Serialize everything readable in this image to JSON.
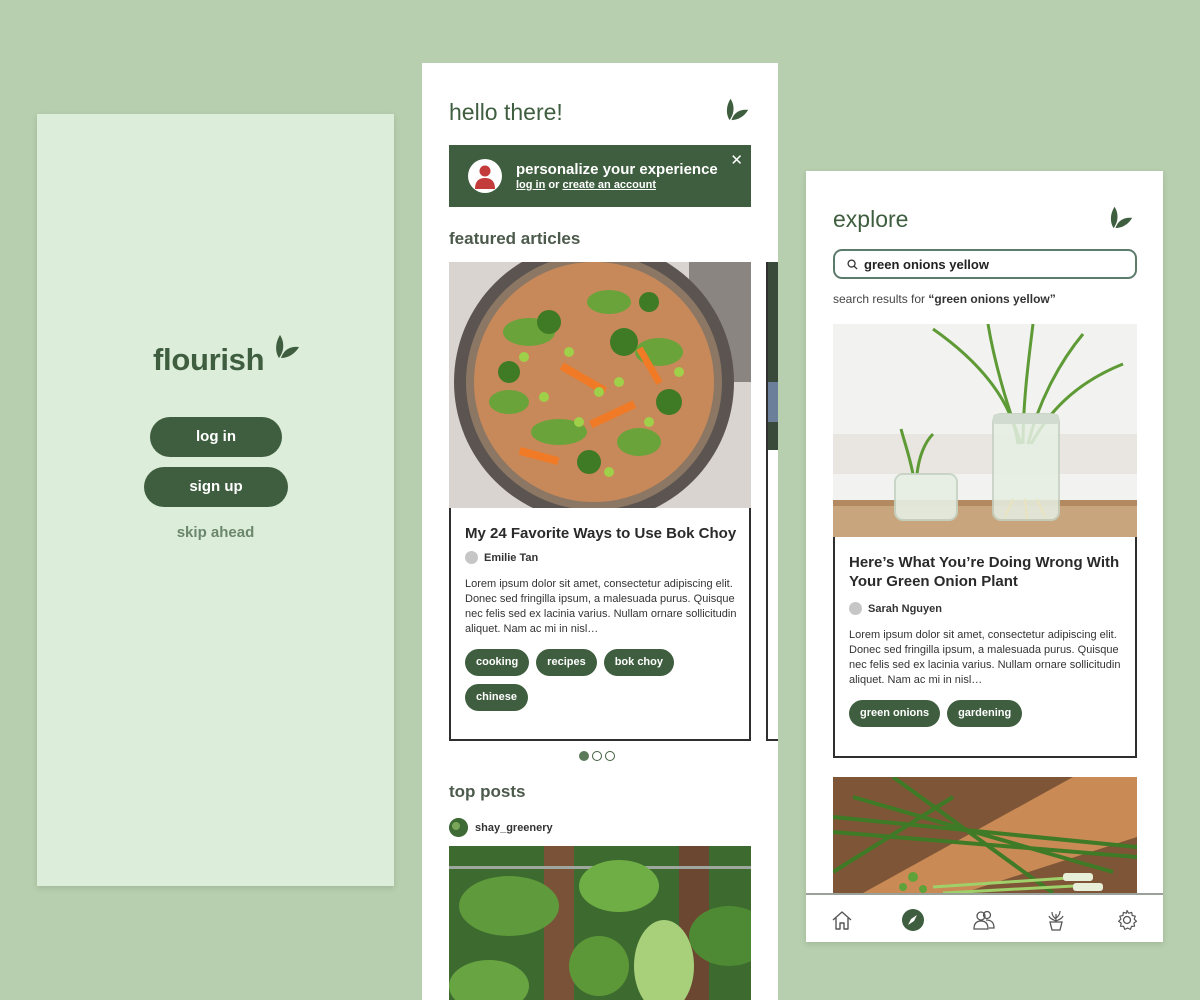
{
  "welcome": {
    "logo_text": "flourish",
    "login_label": "log in",
    "signup_label": "sign up",
    "skip_label": "skip ahead"
  },
  "home": {
    "greeting": "hello there!",
    "banner": {
      "title": "personalize your experience",
      "login_link": "log in",
      "or_text": " or ",
      "create_link": "create an account",
      "close_glyph": "✕"
    },
    "featured_title": "featured articles",
    "featured_article": {
      "title": "My 24 Favorite Ways to Use Bok Choy",
      "author": "Emilie Tan",
      "excerpt": "Lorem ipsum dolor sit amet, consectetur adipiscing elit. Donec sed fringilla ipsum, a malesuada purus. Quisque nec felis sed ex lacinia varius. Nullam ornare sollicitudin aliquet. Nam ac mi in nisl…",
      "tags": [
        "cooking",
        "recipes",
        "bok choy",
        "chinese"
      ]
    },
    "carousel": {
      "pages": 3,
      "active": 0
    },
    "top_posts_title": "top posts",
    "top_post_user": "shay_greenery"
  },
  "explore": {
    "title": "explore",
    "search_value": "green onions yellow",
    "results_prefix": "search results for ",
    "results_query": "“green onions yellow”",
    "article": {
      "title": "Here’s What You’re Doing Wrong With Your Green Onion Plant",
      "author": "Sarah Nguyen",
      "excerpt": "Lorem ipsum dolor sit amet, consectetur adipiscing elit. Donec sed fringilla ipsum, a malesuada purus. Quisque nec felis sed ex lacinia varius. Nullam ornare sollicitudin aliquet. Nam ac mi in nisl…",
      "tags": [
        "green onions",
        "gardening"
      ]
    },
    "nav": [
      {
        "icon": "home-icon"
      },
      {
        "icon": "compass-icon",
        "active": true
      },
      {
        "icon": "community-icon"
      },
      {
        "icon": "plant-pot-icon"
      },
      {
        "icon": "gear-icon"
      }
    ]
  },
  "colors": {
    "background": "#b7cfae",
    "brand_green": "#3f5e3f",
    "welcome_bg": "#dcedda",
    "skip_text": "#6b876b",
    "card_border": "#2f2f2f"
  }
}
